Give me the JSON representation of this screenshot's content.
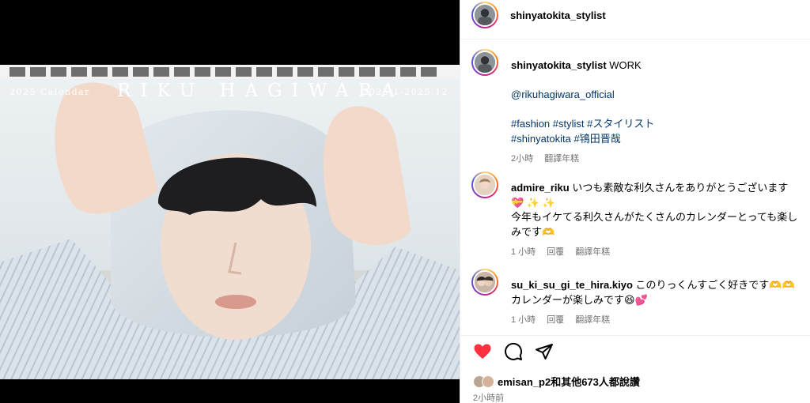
{
  "post": {
    "author": "shinyatokita_stylist"
  },
  "calendar": {
    "year_label": "2025 Calendar",
    "title": "RIKU HAGIWARA",
    "range": "2025.1-2025.12"
  },
  "caption": {
    "username": "shinyatokita_stylist",
    "text": "WORK",
    "mention": "@rikuhagiwara_official",
    "hashtags_line1": "#fashion #stylist #スタイリスト",
    "hashtags_line2": "#shinyatokita #鴇田晋哉",
    "time": "2小時",
    "translate": "翻譯年糕"
  },
  "comments": [
    {
      "username": "admire_riku",
      "text": "いつも素敵な利久さんをありがとうございます",
      "emoji": "💝 ✨ ✨",
      "text2": "今年もイケてる利久さんがたくさんのカレンダーとっても楽しみです🫶",
      "time": "1 小時",
      "reply": "回覆",
      "translate": "翻譯年糕"
    },
    {
      "username": "su_ki_su_gi_te_hira.kiyo",
      "text": "このりっくんすごく好きです🫶🫶",
      "text2": "カレンダーが楽しみです😆💕",
      "time": "1 小時",
      "reply": "回覆",
      "translate": "翻譯年糕"
    }
  ],
  "footer": {
    "likes_text": "emisan_p2和其他673人都說讚",
    "time": "2小時前"
  },
  "colors": {
    "like": "#ff3040",
    "link": "#00376b",
    "muted": "#737373"
  },
  "icons": [
    "heart-icon",
    "comment-icon",
    "share-icon"
  ]
}
